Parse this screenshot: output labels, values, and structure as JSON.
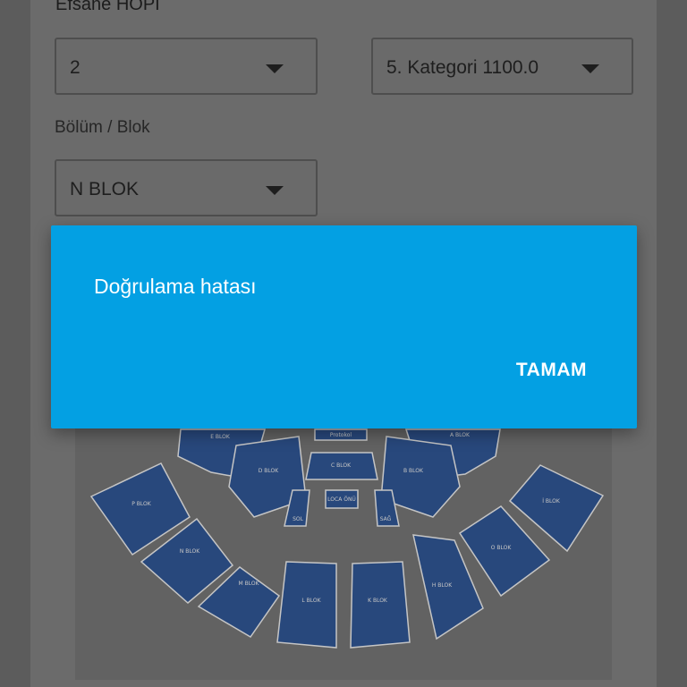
{
  "event": {
    "title": "Efsane HOPI"
  },
  "selectors": {
    "quantity": {
      "value": "2"
    },
    "category": {
      "value": "5. Kategori 1100.0"
    },
    "section_label": "Bölüm / Blok",
    "section": {
      "value": "N BLOK"
    }
  },
  "dialog": {
    "message": "Doğrulama hatası",
    "ok_label": "TAMAM"
  },
  "seat_map": {
    "blocks": [
      "A BLOK",
      "B BLOK",
      "C BLOK",
      "D BLOK",
      "E BLOK",
      "F BLOK",
      "H BLOK",
      "K BLOK",
      "L BLOK",
      "M BLOK",
      "N BLOK",
      "O BLOK",
      "P BLOK",
      "İ BLOK"
    ],
    "center_labels": [
      "LOCA ÖNÜ",
      "SOL BLOK",
      "SAĞ BLOK",
      "Protokol"
    ],
    "colors": {
      "block_fill": "#0f3f8f",
      "block_stroke": "#ffffff"
    }
  },
  "colors": {
    "dialog_bg": "#03a0e3",
    "dim_bg": "#6b6b6b"
  }
}
